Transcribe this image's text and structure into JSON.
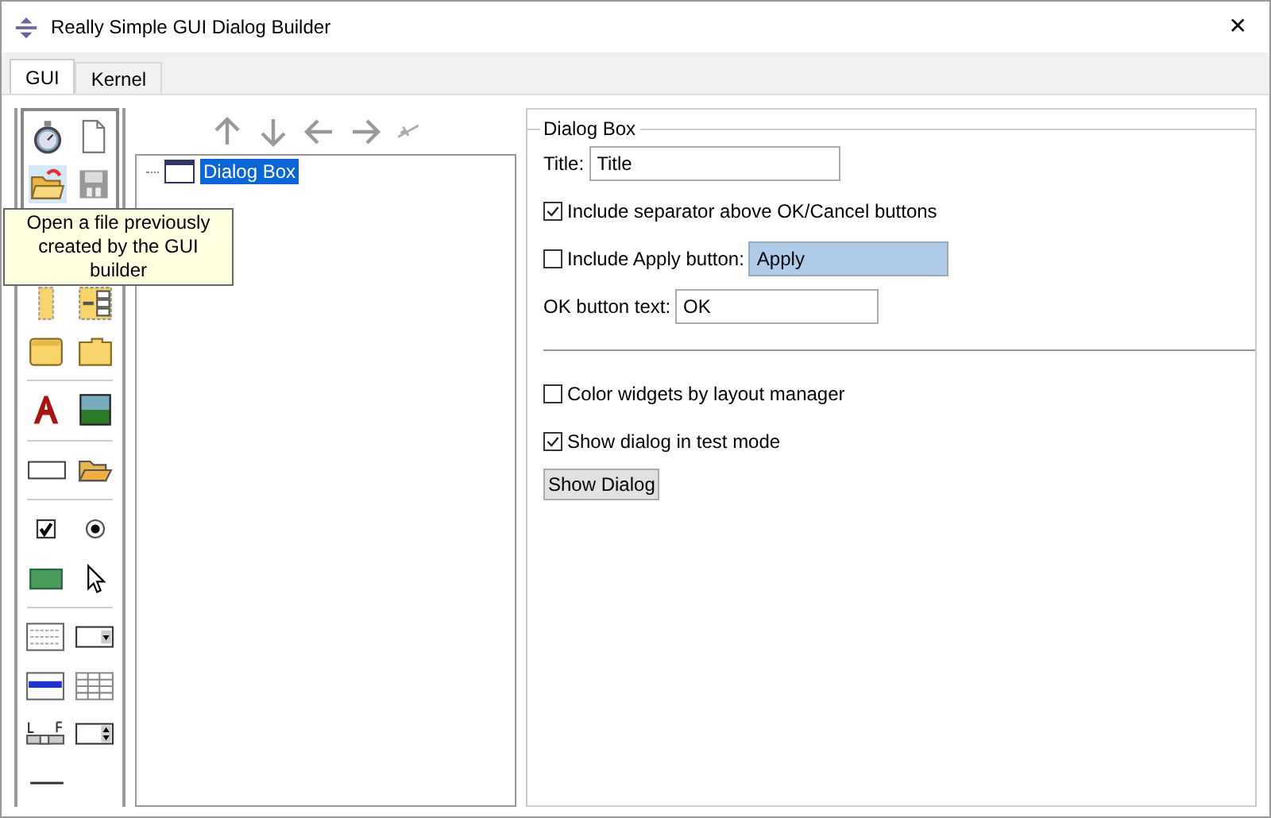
{
  "window": {
    "title": "Really Simple GUI Dialog Builder",
    "close": "✕"
  },
  "tabs": [
    {
      "label": "GUI",
      "selected": true
    },
    {
      "label": "Kernel",
      "selected": false
    }
  ],
  "tooltip": "Open a file previously created by the GUI builder",
  "tree": [
    {
      "label": "Dialog Box",
      "selected": true
    }
  ],
  "properties": {
    "group_title": "Dialog Box",
    "title_label": "Title:",
    "title_value": "Title",
    "separator_checkbox": {
      "label": "Include separator above OK/Cancel buttons",
      "checked": true
    },
    "apply_checkbox": {
      "label": "Include Apply button:",
      "checked": false
    },
    "apply_value": "Apply",
    "apply_highlighted": true,
    "ok_label": "OK button text:",
    "ok_value": "OK",
    "color_checkbox": {
      "label": "Color widgets by layout manager",
      "checked": false
    },
    "test_checkbox": {
      "label": "Show dialog in test mode",
      "checked": true
    },
    "show_button": "Show Dialog"
  }
}
